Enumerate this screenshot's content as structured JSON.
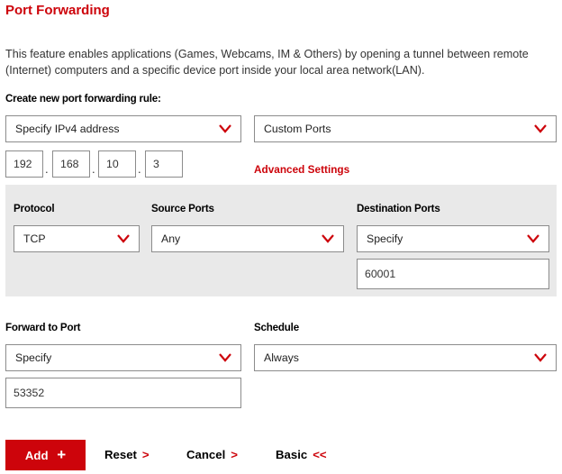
{
  "page": {
    "title": "Port Forwarding",
    "description": "This feature enables applications (Games, Webcams, IM & Others) by opening a tunnel between remote (Internet) computers and a specific device port inside your local area network(LAN)."
  },
  "create_rule": {
    "label": "Create new port forwarding rule:",
    "address_select": "Specify IPv4 address",
    "ports_select": "Custom Ports",
    "ip": [
      "192",
      "168",
      "10",
      "3"
    ],
    "advanced_link": "Advanced Settings"
  },
  "advanced": {
    "protocol_label": "Protocol",
    "protocol_value": "TCP",
    "source_label": "Source Ports",
    "source_value": "Any",
    "dest_label": "Destination Ports",
    "dest_select": "Specify",
    "dest_value": "60001"
  },
  "forward": {
    "label": "Forward to Port",
    "select": "Specify",
    "value": "53352"
  },
  "schedule": {
    "label": "Schedule",
    "select": "Always"
  },
  "buttons": {
    "add": "Add",
    "add_icon": "+",
    "reset": "Reset",
    "reset_icon": ">",
    "cancel": "Cancel",
    "cancel_icon": ">",
    "basic": "Basic",
    "basic_icon": "<<"
  },
  "colors": {
    "accent": "#cd040b",
    "panel": "#e9e9e9"
  }
}
